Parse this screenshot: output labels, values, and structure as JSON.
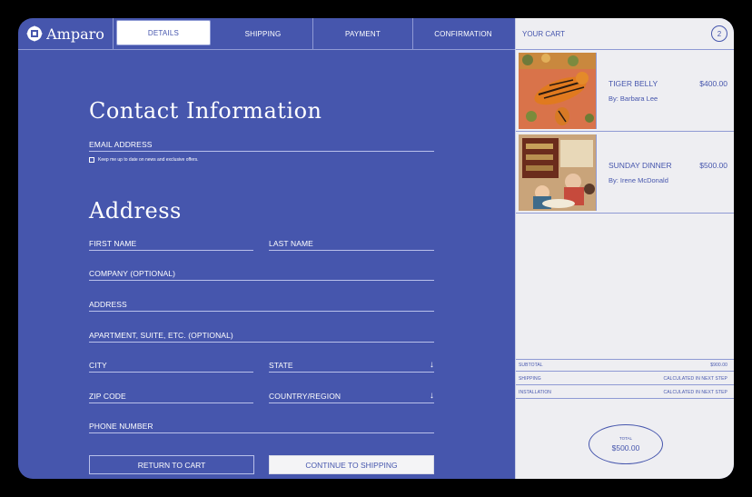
{
  "brand": {
    "name": "Amparo"
  },
  "nav": {
    "tabs": [
      "DETAILS",
      "SHIPPING",
      "PAYMENT",
      "CONFIRMATION"
    ],
    "active": "DETAILS"
  },
  "contact": {
    "title": "Contact Information",
    "email_label": "EMAIL ADDRESS",
    "newsletter_label": "Keep me up to date on news and exclusive offers."
  },
  "address": {
    "title": "Address",
    "first_name": "FIRST NAME",
    "last_name": "LAST NAME",
    "company": "COMPANY (OPTIONAL)",
    "address": "ADDRESS",
    "apartment": "APARTMENT, SUITE, ETC. (OPTIONAL)",
    "city": "CITY",
    "state": "STATE",
    "zip": "ZIP CODE",
    "country": "COUNTRY/REGION",
    "phone": "PHONE NUMBER"
  },
  "actions": {
    "return": "RETURN TO CART",
    "continue": "CONTINUE TO SHIPPING"
  },
  "cart": {
    "title": "YOUR CART",
    "count": "2",
    "items": [
      {
        "name": "TIGER BELLY",
        "by": "By: Barbara Lee",
        "price": "$400.00"
      },
      {
        "name": "SUNDAY DINNER",
        "by": "By: Irene McDonald",
        "price": "$500.00"
      }
    ],
    "summary": [
      {
        "label": "SUBTOTAL",
        "value": "$900.00"
      },
      {
        "label": "SHIPPING",
        "value": "CALCULATED IN NEXT STEP"
      },
      {
        "label": "INSTALLATION",
        "value": "CALCULATED IN NEXT STEP"
      }
    ],
    "total_label": "TOTAL",
    "total_value": "$500.00"
  },
  "colors": {
    "primary": "#4656ad",
    "cart_bg": "#eeeef2",
    "white": "#ffffff"
  }
}
